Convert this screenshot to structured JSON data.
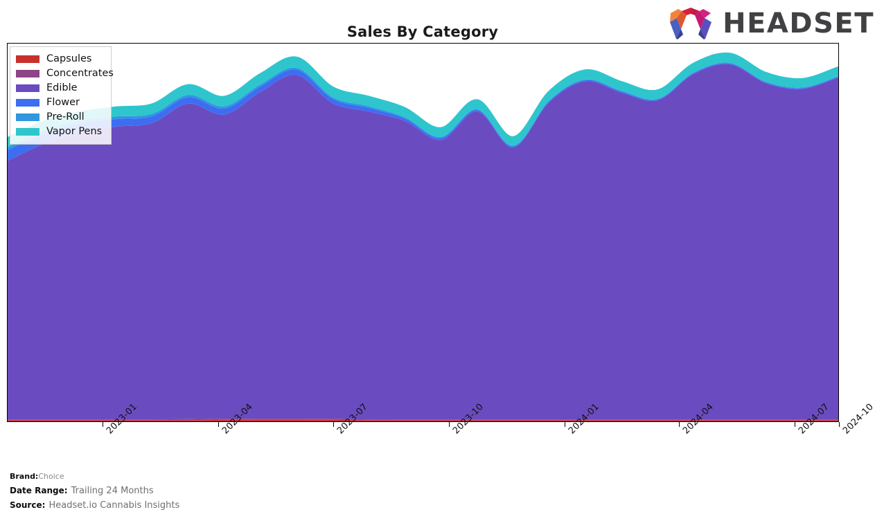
{
  "header": {
    "title": "Sales By Category",
    "logo_text": "HEADSET",
    "logo_icon": "headset-arch-logo"
  },
  "legend": {
    "items": [
      {
        "label": "Capsules",
        "color": "#c9302c"
      },
      {
        "label": "Concentrates",
        "color": "#8e4585"
      },
      {
        "label": "Edible",
        "color": "#6a4cc0"
      },
      {
        "label": "Flower",
        "color": "#3d6ef2"
      },
      {
        "label": "Pre-Roll",
        "color": "#2f97e0"
      },
      {
        "label": "Vapor Pens",
        "color": "#2ec6cc"
      }
    ]
  },
  "footer": {
    "brand_key": "Brand:",
    "brand_value": "Choice",
    "date_range_key": "Date Range:",
    "date_range_value": "Trailing 24 Months",
    "source_key": "Source:",
    "source_value": "Headset.io Cannabis Insights"
  },
  "chart_data": {
    "type": "area",
    "stacked": true,
    "title": "Sales By Category",
    "xlabel": "",
    "ylabel": "",
    "grid": false,
    "legend_position": "top-left",
    "axis": {
      "x_tick_labels": [
        "2023-01",
        "2023-04",
        "2023-07",
        "2023-10",
        "2024-01",
        "2024-04",
        "2024-07",
        "2024-10"
      ],
      "x_tick_positions_pct": [
        11.5,
        25.4,
        39.2,
        53.1,
        67.0,
        80.8,
        94.7,
        100.0
      ],
      "y_axis_visible": false,
      "ylim": [
        0,
        100
      ]
    },
    "x": [
      "2022-11",
      "2022-12",
      "2023-01",
      "2023-02",
      "2023-03",
      "2023-04",
      "2023-05",
      "2023-06",
      "2023-07",
      "2023-08",
      "2023-09",
      "2023-10",
      "2023-11",
      "2023-12",
      "2024-01",
      "2024-02",
      "2024-03",
      "2024-04",
      "2024-05",
      "2024-06",
      "2024-07",
      "2024-08",
      "2024-09",
      "2024-10"
    ],
    "series": [
      {
        "name": "Capsules",
        "color": "#c9302c",
        "values": [
          0.3,
          0.3,
          0.3,
          0.3,
          0.3,
          0.3,
          0.4,
          0.4,
          0.4,
          0.4,
          0.3,
          0.3,
          0.3,
          0.3,
          0.3,
          0.3,
          0.3,
          0.3,
          0.3,
          0.3,
          0.3,
          0.3,
          0.3,
          0.3
        ]
      },
      {
        "name": "Concentrates",
        "color": "#8e4585",
        "values": [
          0.2,
          0.2,
          0.2,
          0.2,
          0.2,
          0.3,
          0.3,
          0.3,
          0.3,
          0.3,
          0.2,
          0.2,
          0.2,
          0.2,
          0.2,
          0.2,
          0.2,
          0.2,
          0.2,
          0.2,
          0.2,
          0.2,
          0.2,
          0.2
        ]
      },
      {
        "name": "Edible",
        "color": "#6a4cc0",
        "values": [
          68.5,
          73.0,
          76.0,
          77.5,
          78.5,
          83.5,
          80.5,
          86.5,
          91.0,
          83.5,
          81.5,
          79.0,
          74.0,
          81.5,
          72.0,
          84.0,
          89.5,
          86.5,
          84.5,
          91.5,
          94.0,
          89.0,
          87.5,
          90.5
        ]
      },
      {
        "name": "Flower",
        "color": "#3d6ef2",
        "values": [
          2.8,
          2.6,
          2.3,
          2.0,
          1.8,
          1.7,
          1.6,
          1.5,
          1.4,
          1.2,
          1.0,
          0.7,
          0.5,
          0.4,
          0.3,
          0.3,
          0.3,
          0.3,
          0.2,
          0.2,
          0.2,
          0.2,
          0.2,
          0.2
        ]
      },
      {
        "name": "Pre-Roll",
        "color": "#2f97e0",
        "values": [
          0.8,
          0.8,
          0.7,
          0.7,
          0.6,
          0.6,
          0.6,
          0.5,
          0.5,
          0.4,
          0.4,
          0.3,
          0.3,
          0.2,
          0.2,
          0.2,
          0.2,
          0.2,
          0.2,
          0.2,
          0.2,
          0.2,
          0.2,
          0.2
        ]
      },
      {
        "name": "Vapor Pens",
        "color": "#2ec6cc",
        "values": [
          2.4,
          2.4,
          2.3,
          2.4,
          2.5,
          2.6,
          2.5,
          2.7,
          2.7,
          2.6,
          2.5,
          2.4,
          2.3,
          2.4,
          2.2,
          2.3,
          2.4,
          2.3,
          2.2,
          2.3,
          2.4,
          2.3,
          2.2,
          2.3
        ]
      }
    ]
  }
}
